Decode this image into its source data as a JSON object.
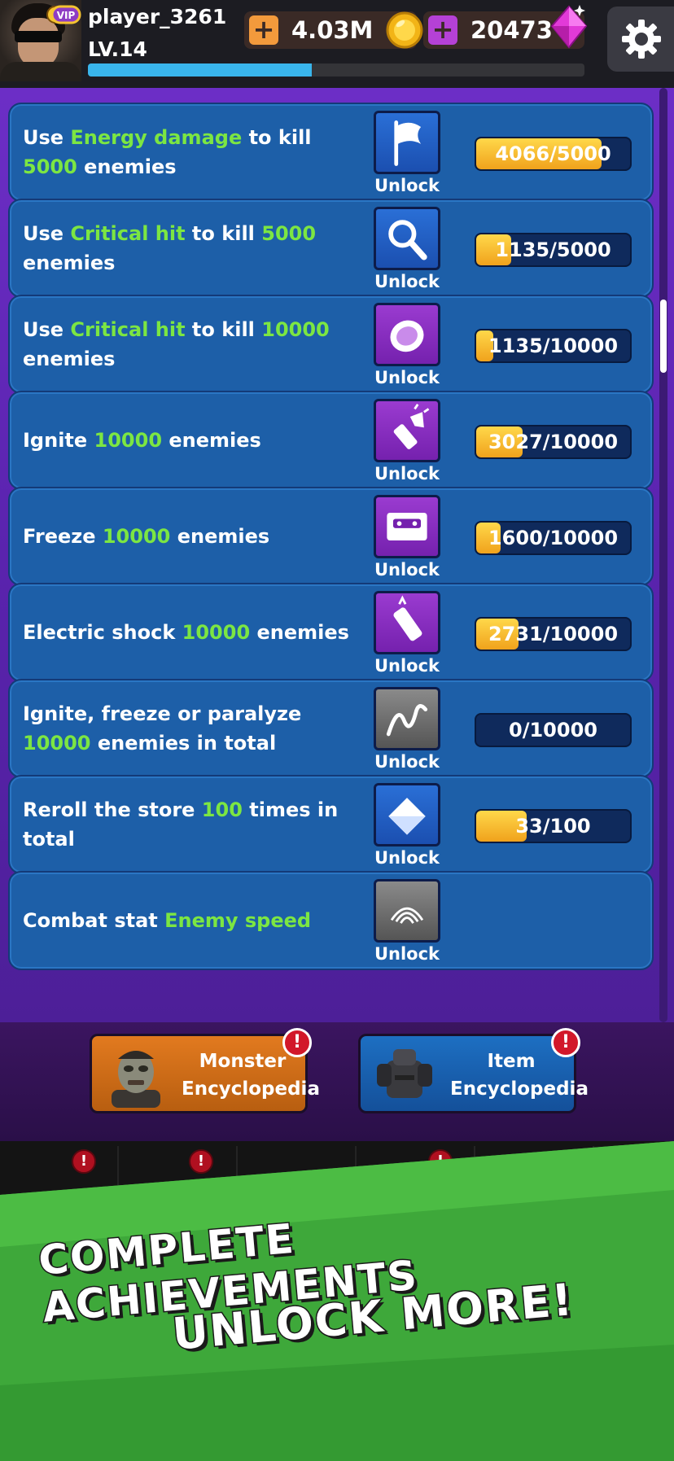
{
  "header": {
    "player_name": "player_3261",
    "vip_label": "VIP",
    "level": "LV.14",
    "xp_progress": 0.45,
    "coins": "4.03M",
    "gems": "20473",
    "plus_symbol": "+"
  },
  "achievements": [
    {
      "parts": [
        [
          "Use ",
          false
        ],
        [
          "Energy damage",
          true
        ],
        [
          " to kill ",
          false
        ],
        [
          "5000",
          true
        ],
        [
          " enemies",
          false
        ]
      ],
      "icon": "flag-icon",
      "icon_color": "blue",
      "unlock_label": "Unlock",
      "progress_text": "4066/5000",
      "current": 4066,
      "target": 5000
    },
    {
      "parts": [
        [
          "Use ",
          false
        ],
        [
          "Critical hit",
          true
        ],
        [
          " to kill ",
          false
        ],
        [
          "5000",
          true
        ],
        [
          " enemies",
          false
        ]
      ],
      "icon": "magnifier-icon",
      "icon_color": "blue",
      "unlock_label": "Unlock",
      "progress_text": "1135/5000",
      "current": 1135,
      "target": 5000
    },
    {
      "parts": [
        [
          "Use ",
          false
        ],
        [
          "Critical hit",
          true
        ],
        [
          " to kill ",
          false
        ],
        [
          "10000",
          true
        ],
        [
          " enemies",
          false
        ]
      ],
      "icon": "coin-stack-icon",
      "icon_color": "purple",
      "unlock_label": "Unlock",
      "progress_text": "1135/10000",
      "current": 1135,
      "target": 10000
    },
    {
      "parts": [
        [
          "Ignite ",
          false
        ],
        [
          "10000",
          true
        ],
        [
          " enemies",
          false
        ]
      ],
      "icon": "flashlight-icon",
      "icon_color": "purple",
      "unlock_label": "Unlock",
      "progress_text": "3027/10000",
      "current": 3027,
      "target": 10000
    },
    {
      "parts": [
        [
          "Freeze ",
          false
        ],
        [
          "10000",
          true
        ],
        [
          " enemies",
          false
        ]
      ],
      "icon": "cassette-icon",
      "icon_color": "purple",
      "unlock_label": "Unlock",
      "progress_text": "1600/10000",
      "current": 1600,
      "target": 10000
    },
    {
      "parts": [
        [
          "Electric shock ",
          false
        ],
        [
          "10000",
          true
        ],
        [
          " enemies",
          false
        ]
      ],
      "icon": "battery-icon",
      "icon_color": "purple",
      "unlock_label": "Unlock",
      "progress_text": "2731/10000",
      "current": 2731,
      "target": 10000
    },
    {
      "parts": [
        [
          "Ignite, freeze or paralyze ",
          false
        ],
        [
          "10000",
          true
        ],
        [
          " enemies in total",
          false
        ]
      ],
      "icon": "wave-icon",
      "icon_color": "gray",
      "unlock_label": "Unlock",
      "progress_text": "0/10000",
      "current": 0,
      "target": 10000
    },
    {
      "parts": [
        [
          "Reroll the store ",
          false
        ],
        [
          "100",
          true
        ],
        [
          " times in total",
          false
        ]
      ],
      "icon": "envelope-icon",
      "icon_color": "blue",
      "unlock_label": "Unlock",
      "progress_text": "33/100",
      "current": 33,
      "target": 100
    },
    {
      "parts": [
        [
          "Combat stat ",
          false
        ],
        [
          "Enemy speed",
          true
        ]
      ],
      "icon": "fingerprint-icon",
      "icon_color": "gray",
      "unlock_label": "Unlock",
      "progress_text": "",
      "current": 0,
      "target": 1
    }
  ],
  "encyclopedia": {
    "monster_label": "Monster Encyclopedia",
    "item_label": "Item Encyclopedia",
    "alert_symbol": "!"
  },
  "promo": {
    "line1": "COMPLETE ACHIEVEMENTS",
    "line2": "UNLOCK MORE!"
  },
  "colors": {
    "highlight": "#7ce642",
    "card_bg": "#1d5fa8",
    "panel_bg": "#5a23ae",
    "progress_fill": "#f0a21c",
    "promo_green": "#3ea83a"
  }
}
